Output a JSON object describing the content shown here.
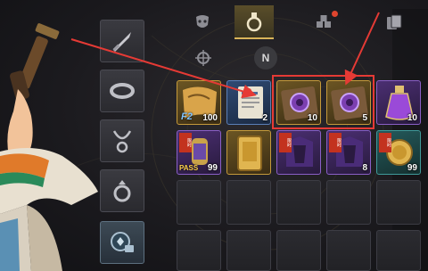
{
  "tabs": [
    {
      "icon": "mask-icon",
      "active": false
    },
    {
      "icon": "potion-icon",
      "active": true
    },
    {
      "icon": "cubes-icon",
      "active": false,
      "notification": true
    },
    {
      "icon": "cards-icon",
      "active": false
    }
  ],
  "subtabs": [
    {
      "icon": "compass-icon",
      "active": false
    },
    {
      "label": "N",
      "active": true
    }
  ],
  "categories": [
    {
      "icon": "sword-icon"
    },
    {
      "icon": "bracelet-icon"
    },
    {
      "icon": "necklace-icon"
    },
    {
      "icon": "ring-icon"
    },
    {
      "icon": "ticket-icon",
      "active": true
    }
  ],
  "items": [
    {
      "name": "map-scroll-item",
      "rarity": "gold",
      "count": "100",
      "tag": "F2"
    },
    {
      "name": "document-item",
      "rarity": "blue",
      "count": "2"
    },
    {
      "name": "purple-seal-chest-item",
      "rarity": "gold",
      "count": "10"
    },
    {
      "name": "purple-seal-chest-item",
      "rarity": "gold",
      "count": "5"
    },
    {
      "name": "purple-elixir-item",
      "rarity": "purple",
      "count": "10"
    },
    {
      "name": "pass-jar-item",
      "rarity": "purple",
      "count": "99",
      "badge": "限时",
      "pass": "PASS"
    },
    {
      "name": "gold-ticket-item",
      "rarity": "gold",
      "count": ""
    },
    {
      "name": "outfit-box-item",
      "rarity": "purple",
      "count": "",
      "badge": "限时"
    },
    {
      "name": "outfit-box-item",
      "rarity": "purple",
      "count": "8",
      "badge": "限时"
    },
    {
      "name": "gold-coin-item",
      "rarity": "teal",
      "count": "99",
      "badge": "限时"
    }
  ],
  "colors": {
    "highlight": "#e53a35",
    "accent_gold": "#d9b45a"
  }
}
